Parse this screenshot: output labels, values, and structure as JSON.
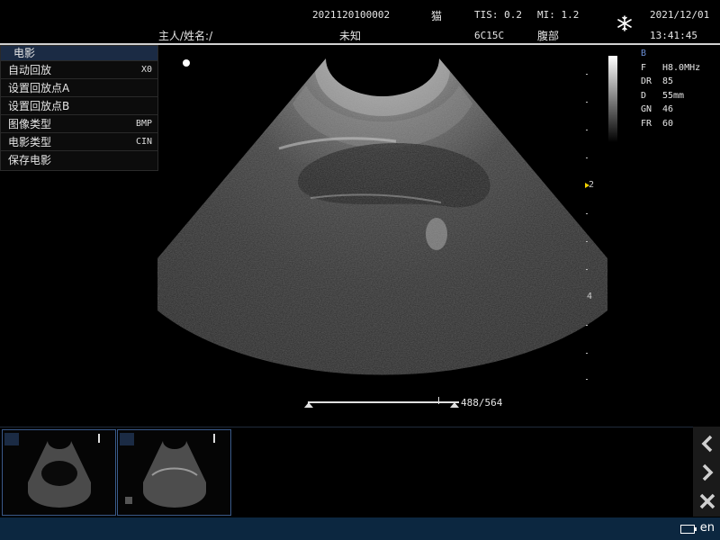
{
  "header": {
    "patient_id": "2021120100002",
    "species": "猫",
    "tis": "TIS: 0.2",
    "mi": "MI: 1.2",
    "date": "2021/12/01",
    "owner_name": "主人/姓名:/",
    "name_value": "未知",
    "probe": "6C15C",
    "exam": "腹部",
    "time": "13:41:45",
    "freeze_icon": "snowflake-icon"
  },
  "cine_menu": {
    "title": "电影",
    "items": [
      {
        "label": "自动回放",
        "value": "X0"
      },
      {
        "label": "设置回放点A",
        "value": ""
      },
      {
        "label": "设置回放点B",
        "value": ""
      },
      {
        "label": "图像类型",
        "value": "BMP"
      },
      {
        "label": "电影类型",
        "value": "CIN"
      },
      {
        "label": "保存电影",
        "value": ""
      }
    ]
  },
  "params": {
    "mode": "B",
    "rows": [
      {
        "k": "F",
        "v": "H8.0MHz"
      },
      {
        "k": "DR",
        "v": "85"
      },
      {
        "k": "D",
        "v": "55mm"
      },
      {
        "k": "GN",
        "v": "46"
      },
      {
        "k": "FR",
        "v": "60"
      }
    ]
  },
  "scale": {
    "labels": [
      "2",
      "4"
    ]
  },
  "cine": {
    "frame_counter": "488/564",
    "position_fraction": 0.865
  },
  "thumbnails": [
    {
      "label": "thumbnail-1"
    },
    {
      "label": "thumbnail-2"
    }
  ],
  "nav": {
    "prev_icon": "chevron-left-icon",
    "next_icon": "chevron-right-icon",
    "delete_icon": "close-icon"
  },
  "statusbar": {
    "battery_icon": "battery-icon",
    "language": "en"
  },
  "colors": {
    "menu_title_bg": "#1b2b44",
    "mode_blue": "#6b8fd6",
    "statusbar_bg": "#0c2740",
    "thumb_border": "#3a5a8a"
  }
}
